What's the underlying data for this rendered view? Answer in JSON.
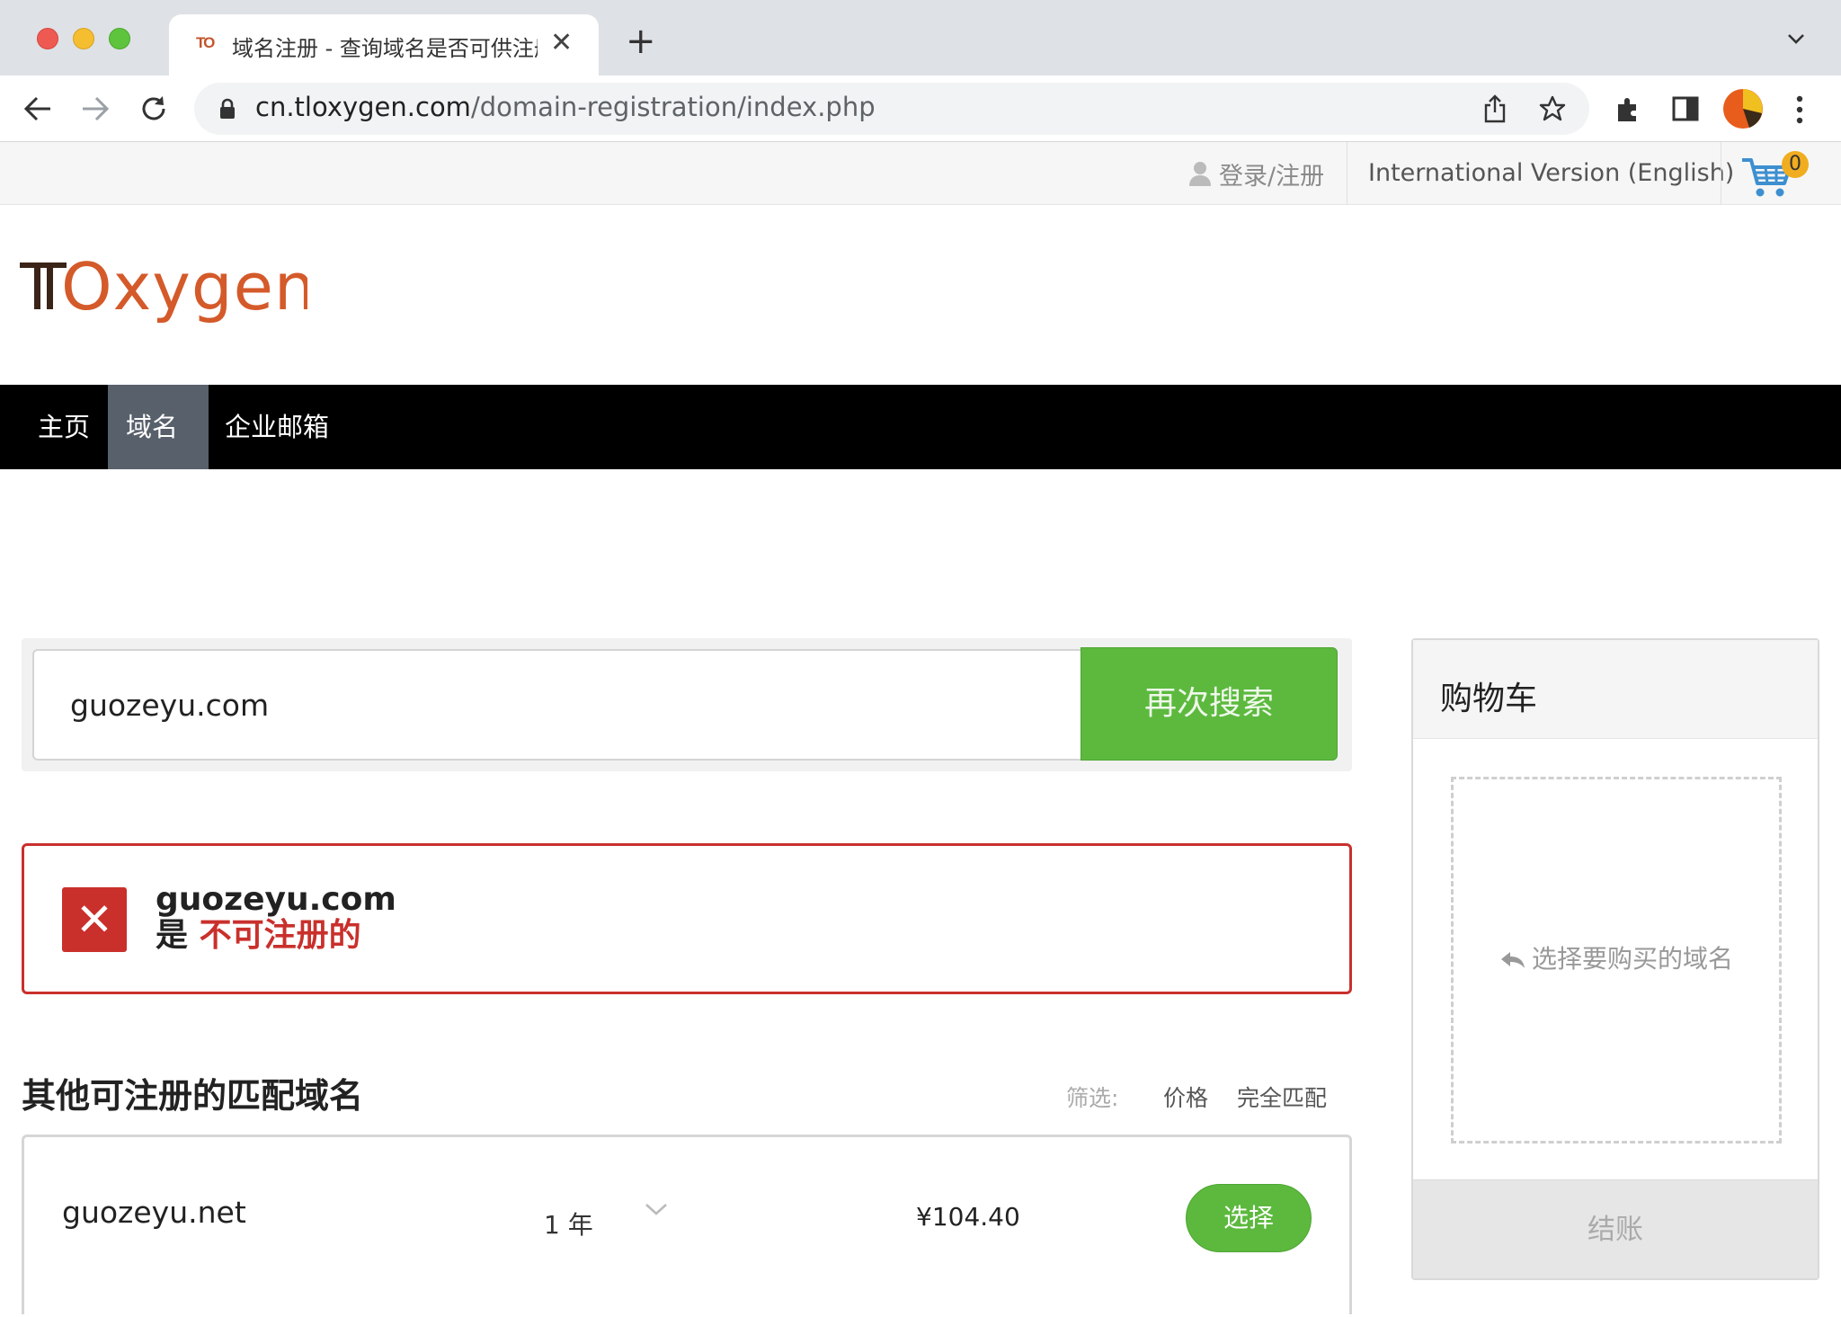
{
  "browser": {
    "tab_favicon": "TO",
    "tab_title": "域名注册 - 查询域名是否可供注册",
    "url_host": "cn.tloxygen.com",
    "url_path": "/domain-registration/index.php"
  },
  "topbar": {
    "login_label": "登录/注册",
    "international_label": "International Version (English)",
    "cart_count": "0"
  },
  "logo": {
    "text": "TOxygen"
  },
  "nav": {
    "items": [
      "主页",
      "域名",
      "企业邮箱"
    ],
    "active_index": 1
  },
  "search": {
    "value": "guozeyu.com",
    "button_label": "再次搜索"
  },
  "result": {
    "domain": "guozeyu.com",
    "prefix": "是",
    "status": "不可注册的"
  },
  "suggestions": {
    "title": "其他可注册的匹配域名",
    "filter_label": "筛选:",
    "filter_options": [
      "价格",
      "完全匹配"
    ],
    "items": [
      {
        "domain": "guozeyu.net",
        "term": "1 年",
        "price": "¥104.40",
        "action_label": "选择"
      }
    ]
  },
  "cart": {
    "title": "购物车",
    "empty_hint": "选择要购买的域名",
    "checkout_label": "结账"
  },
  "colors": {
    "accent_green": "#5cb93e",
    "error_red": "#c9302c",
    "nav_bg": "#000000",
    "nav_active": "#58606b",
    "logo_orange": "#d45a2a"
  }
}
